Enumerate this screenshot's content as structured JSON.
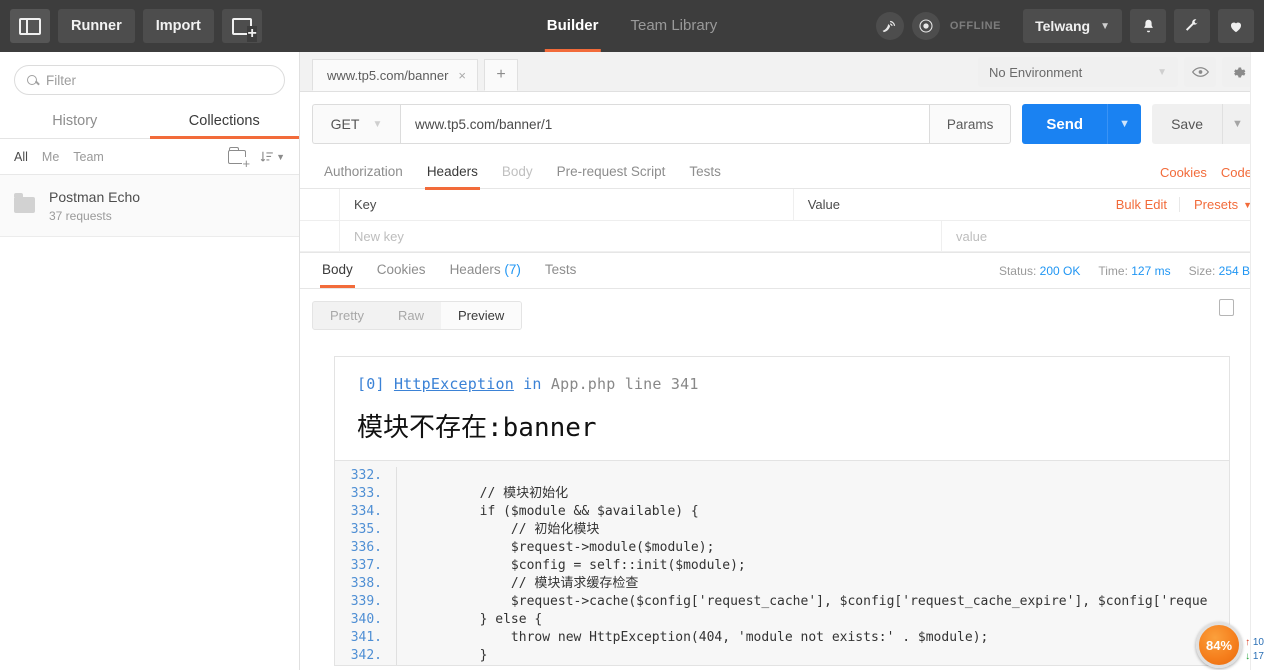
{
  "topbar": {
    "sidebar_toggle": "panel-toggle",
    "runner_label": "Runner",
    "import_label": "Import",
    "new_tab_label": "new-window",
    "tabs": [
      {
        "label": "Builder",
        "active": true
      },
      {
        "label": "Team Library",
        "active": false
      }
    ],
    "sync_status": "OFFLINE",
    "user_name": "Telwang",
    "accent_orange": "#f26b3a",
    "bg": "#3d3d3d"
  },
  "sidebar": {
    "filter_placeholder": "Filter",
    "filter_value": "",
    "tabs": [
      {
        "label": "History",
        "active": false
      },
      {
        "label": "Collections",
        "active": true
      }
    ],
    "scopes": [
      {
        "label": "All",
        "active": true
      },
      {
        "label": "Me",
        "active": false
      },
      {
        "label": "Team",
        "active": false
      }
    ],
    "collections": [
      {
        "name": "Postman Echo",
        "requests": "37 requests"
      }
    ]
  },
  "request": {
    "tabs": [
      {
        "label": "www.tp5.com/banner",
        "close": "×"
      }
    ],
    "add_tab": "+",
    "environment": "No Environment",
    "method": "GET",
    "url": "www.tp5.com/banner/1",
    "params_label": "Params",
    "send_label": "Send",
    "save_label": "Save",
    "section_tabs": [
      {
        "label": "Authorization",
        "active": false,
        "disabled": false
      },
      {
        "label": "Headers",
        "active": true,
        "disabled": false
      },
      {
        "label": "Body",
        "active": false,
        "disabled": true
      },
      {
        "label": "Pre-request Script",
        "active": false,
        "disabled": false
      },
      {
        "label": "Tests",
        "active": false,
        "disabled": false
      }
    ],
    "cookies_label": "Cookies",
    "code_label": "Code",
    "headers_table": {
      "col_key": "Key",
      "col_value": "Value",
      "bulk_edit": "Bulk Edit",
      "presets": "Presets",
      "new_key_placeholder": "New key",
      "new_value_placeholder": "value",
      "rows": []
    }
  },
  "response": {
    "tabs": [
      {
        "label": "Body",
        "active": true,
        "count": ""
      },
      {
        "label": "Cookies",
        "active": false,
        "count": ""
      },
      {
        "label": "Headers",
        "active": false,
        "count": "(7)"
      },
      {
        "label": "Tests",
        "active": false,
        "count": ""
      }
    ],
    "status_label": "Status:",
    "status_value": "200 OK",
    "time_label": "Time:",
    "time_value": "127 ms",
    "size_label": "Size:",
    "size_value": "254 B",
    "formats": [
      {
        "label": "Pretty",
        "active": false
      },
      {
        "label": "Raw",
        "active": false
      },
      {
        "label": "Preview",
        "active": true
      }
    ],
    "copy_icon": "copy-icon",
    "preview": {
      "exc_index": "[0]",
      "exc_class": "HttpException",
      "exc_in": "in",
      "exc_file": "App.php line 341",
      "exc_message": "模块不存在:banner",
      "code_lines": [
        {
          "n": "332.",
          "code": ""
        },
        {
          "n": "333.",
          "code": "        // 模块初始化"
        },
        {
          "n": "334.",
          "code": "        if ($module && $available) {"
        },
        {
          "n": "335.",
          "code": "            // 初始化模块"
        },
        {
          "n": "336.",
          "code": "            $request->module($module);"
        },
        {
          "n": "337.",
          "code": "            $config = self::init($module);"
        },
        {
          "n": "338.",
          "code": "            // 模块请求缓存检查"
        },
        {
          "n": "339.",
          "code": "            $request->cache($config['request_cache'], $config['request_cache_expire'], $config['reque"
        },
        {
          "n": "340.",
          "code": "        } else {"
        },
        {
          "n": "341.",
          "code": "            throw new HttpException(404, 'module not exists:' . $module);"
        },
        {
          "n": "342.",
          "code": "        }"
        }
      ]
    }
  },
  "zoom_widget": {
    "percent": "84%",
    "up_value": "10",
    "down_value": "17"
  }
}
